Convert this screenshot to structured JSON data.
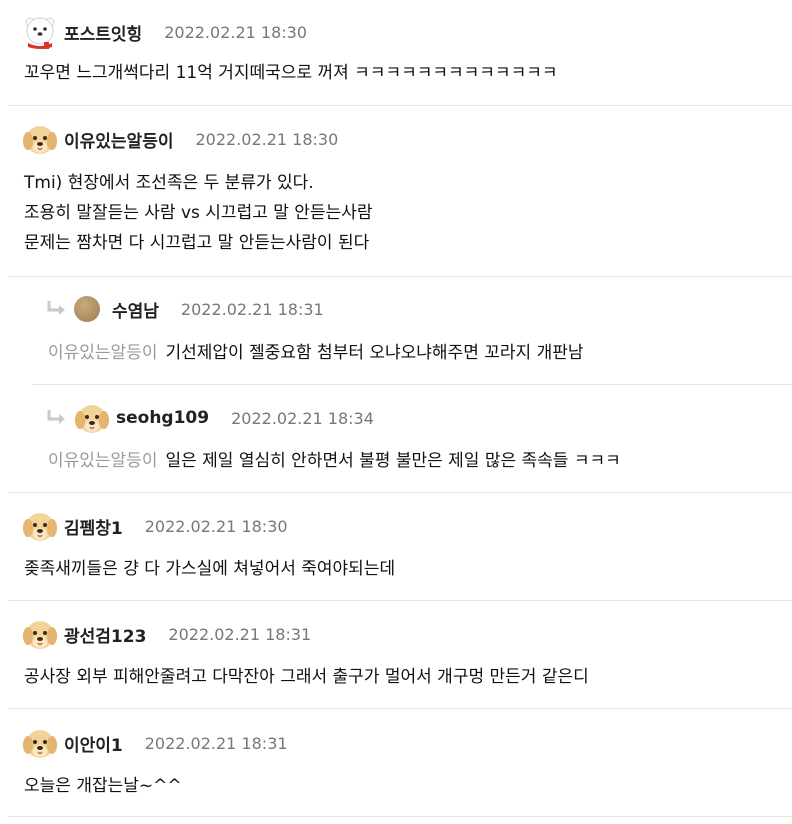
{
  "comments": [
    {
      "nick": "포스트잇힝",
      "date": "2022.02.21 18:30",
      "avatar": "polar-bear-avatar-icon",
      "lines": [
        "꼬우면 느그개썩다리 11억 거지떼국으로 꺼져 ㅋㅋㅋㅋㅋㅋㅋㅋㅋㅋㅋㅋㅋ"
      ]
    },
    {
      "nick": "이유있는알등이",
      "date": "2022.02.21 18:30",
      "avatar": "puppy-avatar-icon",
      "lines": [
        "Tmi) 현장에서 조선족은 두 분류가 있다.",
        "조용히 말잘듣는 사람 vs 시끄럽고 말 안듣는사람",
        "문제는 짬차면 다 시끄럽고 말 안듣는사람이 된다"
      ]
    },
    {
      "nick": "수염남",
      "date": "2022.02.21 18:31",
      "avatar": "round-brown-avatar-icon",
      "mention": "이유있는알등이",
      "text": "기선제압이 젤중요함 첨부터 오냐오냐해주면 꼬라지 개판남"
    },
    {
      "nick": "seohg109",
      "date": "2022.02.21 18:34",
      "avatar": "puppy-avatar-icon",
      "mention": "이유있는알등이",
      "text": "일은 제일 열심히 안하면서 불평 불만은 제일 많은 족속들 ㅋㅋㅋ"
    },
    {
      "nick": "김펨창1",
      "date": "2022.02.21 18:30",
      "avatar": "puppy-avatar-icon",
      "lines": [
        "좆족새끼들은 걍 다 가스실에 쳐넣어서 죽여야되는데"
      ]
    },
    {
      "nick": "광선검123",
      "date": "2022.02.21 18:31",
      "avatar": "puppy-avatar-icon",
      "lines": [
        "공사장 외부 피해안줄려고 다막잔아 그래서 출구가 멀어서 개구멍 만든거 같은디"
      ]
    },
    {
      "nick": "이안이1",
      "date": "2022.02.21 18:31",
      "avatar": "puppy-avatar-icon",
      "lines": [
        "오늘은 개잡는날~^^"
      ]
    }
  ],
  "colors": {
    "nick": "#222222",
    "date": "#777777",
    "mention": "#9a9a9a",
    "divider": "#e6e6e6",
    "reply_arrow": "#c9c9c9"
  }
}
